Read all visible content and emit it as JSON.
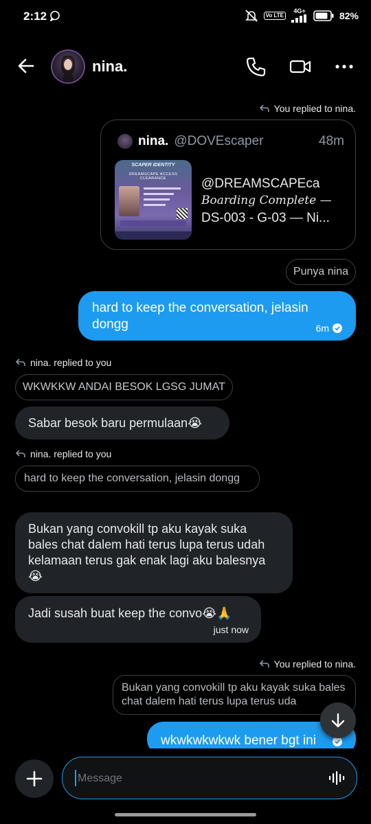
{
  "status_bar": {
    "time": "2:12",
    "network": "4G+",
    "volte": "Vo LTE",
    "battery": "82%"
  },
  "header": {
    "contact_name": "nina."
  },
  "messages": {
    "reply_label_1": "You replied to nina.",
    "quote_card": {
      "name": "nina.",
      "handle": "@DOVEscaper",
      "time": "48m",
      "link_title": "@DREAMSCAPEca",
      "link_line2": "Boarding Complete —",
      "link_line3": "DS-003 - G-03 — Ni...",
      "image_title": "SCAPER IDENTITY",
      "image_sub": "DREAMSCAPE ACCESS CLEARANCE"
    },
    "pill_1": "Punya nina",
    "out_1": "hard to keep the conversation, jelasin dongg",
    "out_1_time": "6m",
    "reply_label_2": "nina. replied to you",
    "quote_in_1": "WKWKKW ANDAI BESOK LGSG JUMAT",
    "in_1": "Sabar besok baru permulaan😭",
    "reply_label_3": "nina. replied to you",
    "quote_in_2": "hard to keep the conversation, jelasin dongg",
    "in_2": "Bukan yang convokill tp aku kayak suka bales chat dalem hati terus lupa terus udah kelamaan terus gak enak lagi aku balesnya😭",
    "in_3": "Jadi susah buat keep the convo😭🙏",
    "in_3_time": "just now",
    "reply_label_4": "You replied to nina.",
    "quote_out": "Bukan yang convokill tp aku kayak suka bales chat dalem hati terus lupa terus uda",
    "out_2": "wkwkwkwkwk bener bgt ini"
  },
  "composer": {
    "placeholder": "Message"
  },
  "colors": {
    "accent": "#1d9bf0",
    "background": "#000000",
    "bubble_in": "#202327"
  }
}
